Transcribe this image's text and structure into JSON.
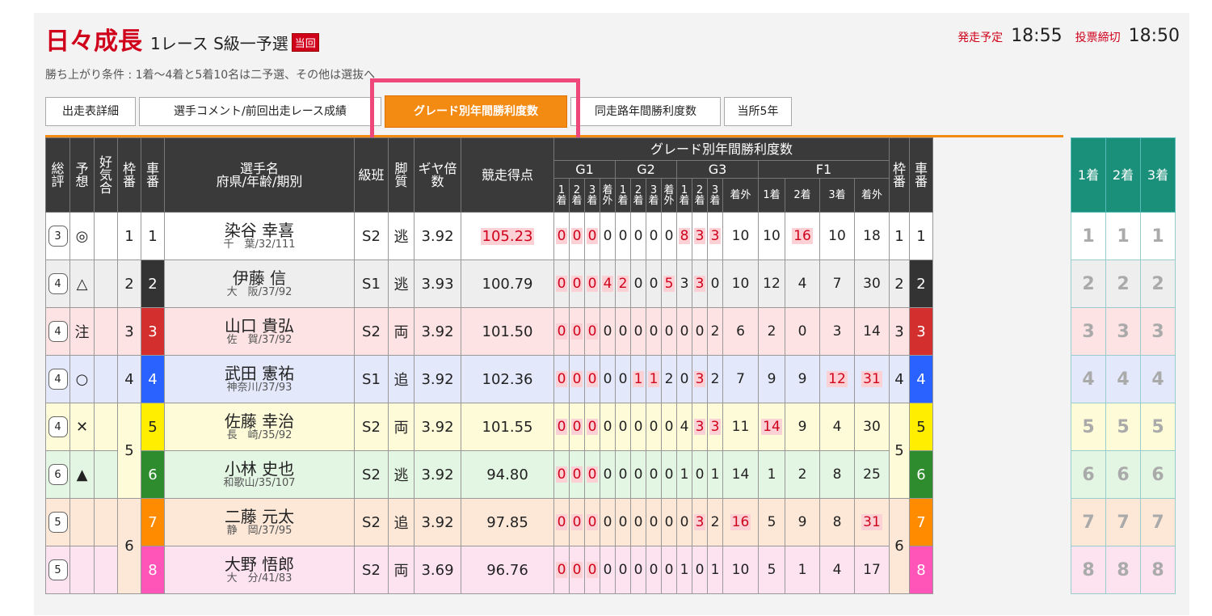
{
  "header": {
    "title_main": "日々成長",
    "title_race": "1レース S級一予選",
    "badge": "当回",
    "start_label": "発走予定",
    "start_time": "18:55",
    "deadline_label": "投票締切",
    "deadline_time": "18:50"
  },
  "condition": "勝ち上がり条件 : 1着〜4着と5着10名は二予選、その他は選抜へ",
  "tabs": [
    "出走表詳細",
    "選手コメント/前回出走レース成績",
    "グレード別年間勝利度数",
    "同走路年間勝利度数",
    "当所5年"
  ],
  "columns": {
    "souhyo": "総評",
    "yosou": "予想",
    "kouki": "好気合",
    "waku": "枠番",
    "sha": "車番",
    "name": "選手名",
    "name_sub": "府県/年齢/期別",
    "kyu": "級班",
    "kyaku": "脚質",
    "gear": "ギヤ倍数",
    "score": "競走得点",
    "grade_title": "グレード別年間勝利度数",
    "g1": "G1",
    "g2": "G2",
    "g3": "G3",
    "f1": "F1",
    "p1": "1着",
    "p2": "2着",
    "p3": "3着",
    "out": "着外"
  },
  "side_headers": [
    "1着",
    "2着",
    "3着"
  ],
  "rows": [
    {
      "eval": "3",
      "mark": "◎",
      "waku": "1",
      "car": "1",
      "name": "染谷 幸喜",
      "info": "千　葉/32/111",
      "kyu": "S2",
      "kyaku": "逃",
      "gear": "3.92",
      "score": "105.23",
      "g1": [
        "0",
        "0",
        "0",
        "0"
      ],
      "g2": [
        "0",
        "0",
        "0",
        "0"
      ],
      "g3": [
        "8",
        "3",
        "3",
        "10"
      ],
      "f1": [
        "10",
        "16",
        "10",
        "18"
      ],
      "bg": "#ffffff",
      "carbg": "#ffffff",
      "carfg": "#222"
    },
    {
      "eval": "4",
      "mark": "△",
      "waku": "2",
      "car": "2",
      "name": "伊藤 信",
      "info": "大　阪/37/92",
      "kyu": "S1",
      "kyaku": "逃",
      "gear": "3.93",
      "score": "100.79",
      "g1": [
        "0",
        "0",
        "0",
        "4"
      ],
      "g2": [
        "2",
        "0",
        "0",
        "5"
      ],
      "g3": [
        "3",
        "3",
        "0",
        "10"
      ],
      "f1": [
        "12",
        "4",
        "7",
        "30"
      ],
      "bg": "#eeeeee",
      "carbg": "#333333",
      "carfg": "#fff"
    },
    {
      "eval": "4",
      "mark": "注",
      "waku": "3",
      "car": "3",
      "name": "山口 貴弘",
      "info": "佐　賀/37/92",
      "kyu": "S2",
      "kyaku": "両",
      "gear": "3.92",
      "score": "101.50",
      "g1": [
        "0",
        "0",
        "0",
        "0"
      ],
      "g2": [
        "0",
        "0",
        "0",
        "0"
      ],
      "g3": [
        "0",
        "0",
        "2",
        "6"
      ],
      "f1": [
        "2",
        "0",
        "3",
        "14"
      ],
      "bg": "#fde3e3",
      "carbg": "#d32f2f",
      "carfg": "#fff"
    },
    {
      "eval": "4",
      "mark": "○",
      "waku": "4",
      "car": "4",
      "name": "武田 憲祐",
      "info": "神奈川/37/93",
      "kyu": "S1",
      "kyaku": "追",
      "gear": "3.92",
      "score": "102.36",
      "g1": [
        "0",
        "0",
        "0",
        "0"
      ],
      "g2": [
        "0",
        "1",
        "1",
        "2"
      ],
      "g3": [
        "0",
        "3",
        "2",
        "7"
      ],
      "f1": [
        "9",
        "9",
        "12",
        "31"
      ],
      "bg": "#e3e8fb",
      "carbg": "#2962ff",
      "carfg": "#fff"
    },
    {
      "eval": "4",
      "mark": "✕",
      "waku": "5",
      "car": "5",
      "name": "佐藤 幸治",
      "info": "長　崎/35/92",
      "kyu": "S2",
      "kyaku": "両",
      "gear": "3.92",
      "score": "101.55",
      "g1": [
        "0",
        "0",
        "0",
        "0"
      ],
      "g2": [
        "0",
        "0",
        "0",
        "0"
      ],
      "g3": [
        "4",
        "3",
        "3",
        "11"
      ],
      "f1": [
        "14",
        "9",
        "4",
        "30"
      ],
      "bg": "#fdfbd8",
      "carbg": "#ffee00",
      "carfg": "#222"
    },
    {
      "eval": "6",
      "mark": "▲",
      "waku": "",
      "car": "6",
      "name": "小林 史也",
      "info": "和歌山/35/107",
      "kyu": "S2",
      "kyaku": "逃",
      "gear": "3.92",
      "score": "94.80",
      "g1": [
        "0",
        "0",
        "0",
        "0"
      ],
      "g2": [
        "0",
        "0",
        "0",
        "0"
      ],
      "g3": [
        "1",
        "0",
        "1",
        "14"
      ],
      "f1": [
        "1",
        "2",
        "8",
        "25"
      ],
      "bg": "#e3f5e3",
      "carbg": "#2e8b2e",
      "carfg": "#fff"
    },
    {
      "eval": "5",
      "mark": "",
      "waku": "6",
      "car": "7",
      "name": "二藤 元太",
      "info": "静　岡/37/95",
      "kyu": "S2",
      "kyaku": "追",
      "gear": "3.92",
      "score": "97.85",
      "g1": [
        "0",
        "0",
        "0",
        "0"
      ],
      "g2": [
        "0",
        "0",
        "0",
        "0"
      ],
      "g3": [
        "0",
        "3",
        "2",
        "16"
      ],
      "f1": [
        "5",
        "9",
        "8",
        "31"
      ],
      "bg": "#fde8d8",
      "carbg": "#ff8c00",
      "carfg": "#fff"
    },
    {
      "eval": "5",
      "mark": "",
      "waku": "",
      "car": "8",
      "name": "大野 悟郎",
      "info": "大　分/41/83",
      "kyu": "S2",
      "kyaku": "両",
      "gear": "3.69",
      "score": "96.76",
      "g1": [
        "0",
        "0",
        "0",
        "0"
      ],
      "g2": [
        "0",
        "0",
        "0",
        "0"
      ],
      "g3": [
        "1",
        "0",
        "1",
        "10"
      ],
      "f1": [
        "5",
        "1",
        "4",
        "17"
      ],
      "bg": "#fde3ef",
      "carbg": "#ff55b8",
      "carfg": "#fff"
    }
  ],
  "highlights": {
    "score": [
      "105.23"
    ],
    "cells": {
      "0": [
        "g1.0",
        "g1.1",
        "g1.2",
        "g3.0",
        "g3.1",
        "g3.2",
        "f1.1"
      ],
      "1": [
        "g1.0",
        "g1.1",
        "g1.2",
        "g1.3",
        "g2.0",
        "g2.3",
        "g3.1"
      ],
      "2": [
        "g1.0",
        "g1.1",
        "g1.2"
      ],
      "3": [
        "g1.0",
        "g1.1",
        "g1.2",
        "g2.1",
        "g2.2",
        "g3.1",
        "f1.2",
        "f1.3"
      ],
      "4": [
        "g1.0",
        "g1.1",
        "g1.2",
        "g3.1",
        "g3.2",
        "f1.0"
      ],
      "5": [
        "g1.0",
        "g1.1",
        "g1.2"
      ],
      "6": [
        "g1.0",
        "g1.1",
        "g1.2",
        "g3.1",
        "g3.3",
        "f1.3"
      ],
      "7": [
        "g1.0",
        "g1.1",
        "g1.2"
      ]
    }
  }
}
